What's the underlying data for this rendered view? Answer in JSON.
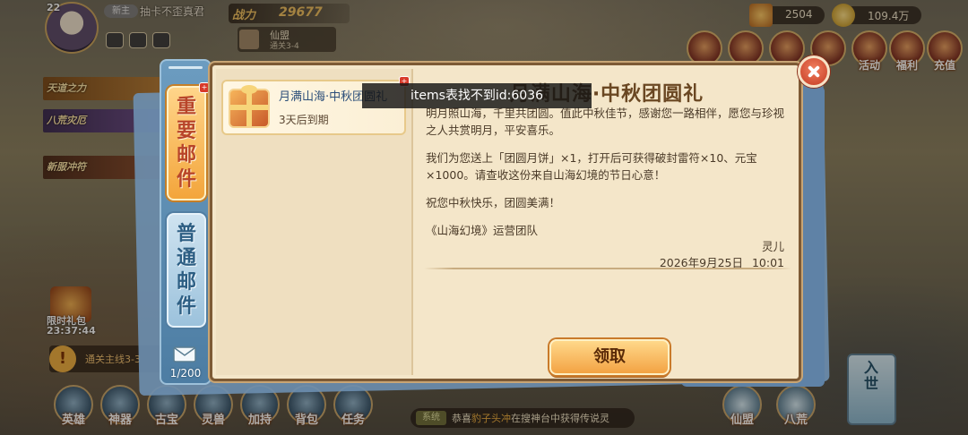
{
  "player": {
    "level": "22",
    "badge": "新主",
    "name": "抽卡不歪真君"
  },
  "power": {
    "label": "战力",
    "value": "29677"
  },
  "guild": {
    "name": "仙盟",
    "stage": "通关3-4"
  },
  "currencies": [
    {
      "icon": "ingot-icon",
      "value": "2504"
    },
    {
      "icon": "gold-coin-icon",
      "value": "109.4万"
    }
  ],
  "hud_menu": [
    "活动",
    "福利",
    "充值"
  ],
  "left_banners": [
    "天道之力",
    "八荒灾厄",
    "新服冲符"
  ],
  "side_event": {
    "label": "限时礼包",
    "timer": "23:37:44"
  },
  "quest": {
    "text": "通关主线3-3"
  },
  "bottom_nav": [
    "英雄",
    "神器",
    "古宝",
    "灵兽",
    "加持",
    "背包",
    "任务"
  ],
  "ticker": {
    "tag": "系统",
    "prefix": "恭喜",
    "name": "豹子头冲",
    "suffix": "在搜神台中获得传说灵"
  },
  "bottom_right": [
    "仙盟",
    "八荒"
  ],
  "right_scroll": "入世",
  "mail": {
    "tabs": {
      "important": "重要邮件",
      "normal": "普通邮件"
    },
    "count": "1/200",
    "list": [
      {
        "title": "月满山海·中秋团圆礼",
        "expire": "3天后到期"
      }
    ],
    "heading": "月满山海·中秋团圆礼",
    "body": [
      "明月照山海，千里共团圆。值此中秋佳节，感谢您一路相伴，愿您与珍视之人共赏明月，平安喜乐。",
      "我们为您送上「团圆月饼」×1，打开后可获得破封雷符×10、元宝×1000。请查收这份来自山海幻境的节日心意！",
      "祝您中秋快乐，团圆美满！",
      "《山海幻境》运营团队"
    ],
    "signer": "灵儿",
    "date": "2026年9月25日",
    "time": "10:01",
    "claim_label": "领取"
  },
  "toast": "items表找不到id:6036",
  "colors": {
    "important_tab": "#f3a53b",
    "normal_tab": "#9cc2dc",
    "panel": "#f4e6c9",
    "claim_button": "#f3a343",
    "close_button": "#c53a22"
  }
}
